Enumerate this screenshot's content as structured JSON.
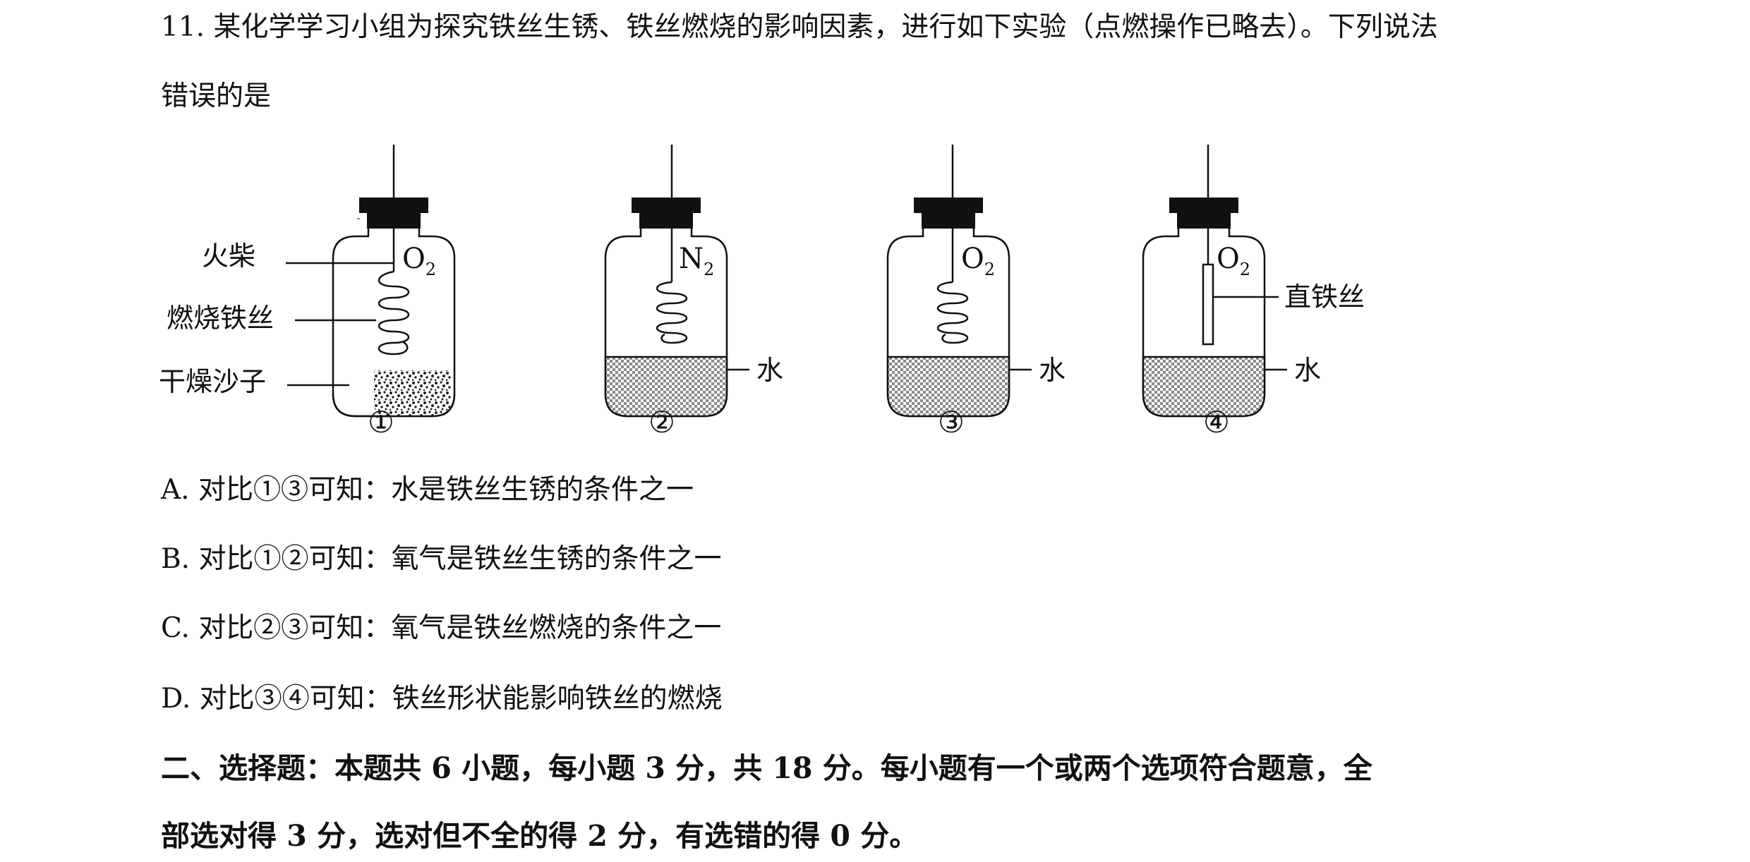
{
  "question": {
    "line1": "11. 某化学学习小组为探究铁丝生锈、铁丝燃烧的影响因素，进行如下实验（点燃操作已略去）。下列说法",
    "line2": "错误的是"
  },
  "figure": {
    "labels": {
      "match": "火柴",
      "burning_wire": "燃烧铁丝",
      "dry_sand": "干燥沙子",
      "straight_wire": "直铁丝",
      "water": "水"
    },
    "gases": {
      "jar1": {
        "symbol": "O",
        "sub": "2"
      },
      "jar2": {
        "symbol": "N",
        "sub": "2"
      },
      "jar3": {
        "symbol": "O",
        "sub": "2"
      },
      "jar4": {
        "symbol": "O",
        "sub": "2"
      }
    },
    "jar_numbers": [
      "①",
      "②",
      "③",
      "④"
    ]
  },
  "options": [
    {
      "text": "A. 对比①③可知：水是铁丝生锈的条件之一"
    },
    {
      "text": "B. 对比①②可知：氧气是铁丝生锈的条件之一"
    },
    {
      "text": "C. 对比②③可知：氧气是铁丝燃烧的条件之一"
    },
    {
      "text": "D. 对比③④可知：铁丝形状能影响铁丝的燃烧"
    }
  ],
  "section": {
    "line1": "二、选择题：本题共 6 小题，每小题 3 分，共 18 分。每小题有一个或两个选项符合题意，全",
    "line2": "部选对得 3 分，选对但不全的得 2 分，有选错的得 0 分。"
  }
}
